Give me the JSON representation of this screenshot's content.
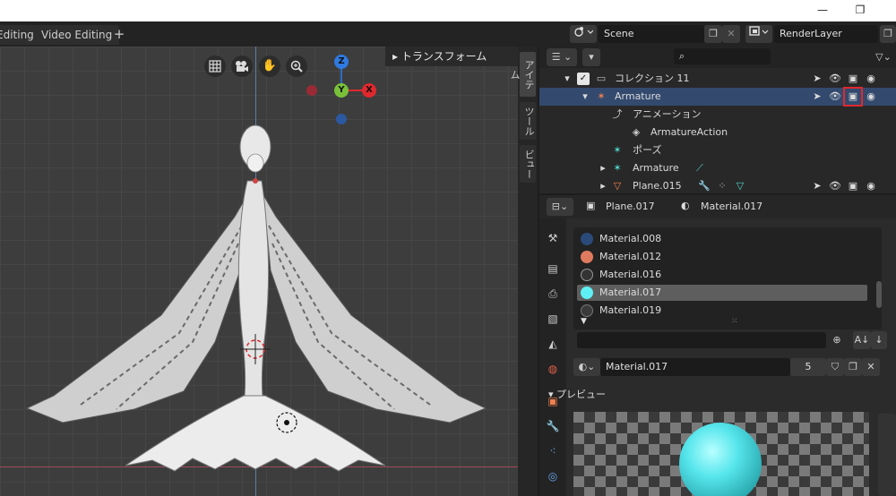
{
  "window": {
    "minimize": "—",
    "restore": "❐"
  },
  "workspace_tabs": [
    {
      "label": "Editing"
    },
    {
      "label": "Video Editing"
    }
  ],
  "workspace_add": "+",
  "scene": {
    "name": "Scene",
    "render_layer": "RenderLayer"
  },
  "viewport": {
    "nav_icons": [
      "grid-icon",
      "camera-icon",
      "hand-icon",
      "zoom-icon"
    ],
    "gizmo": {
      "z": "Z",
      "y": "Y",
      "x": "X"
    },
    "transform_header": "トランスフォーム"
  },
  "side_tabs": [
    "アイテム",
    "ツール",
    "ビュー"
  ],
  "outliner": {
    "search_placeholder": "",
    "rows": [
      {
        "label": "コレクション 11"
      },
      {
        "label": "Armature"
      },
      {
        "label": "アニメーション"
      },
      {
        "label": "ArmatureAction"
      },
      {
        "label": "ポーズ"
      },
      {
        "label": "Armature"
      },
      {
        "label": "Plane.015"
      }
    ]
  },
  "properties": {
    "object_name": "Plane.017",
    "material_name": "Material.017",
    "materials": [
      {
        "name": "Material.008",
        "color": "#2b4a7a"
      },
      {
        "name": "Material.012",
        "color": "#e07a5f"
      },
      {
        "name": "Material.016",
        "color": "#333333"
      },
      {
        "name": "Material.017",
        "color": "#5ef0f5"
      },
      {
        "name": "Material.019",
        "color": "#3a3a3a"
      }
    ],
    "slot_name": "Material.017",
    "user_count": "5",
    "preview_label": "プレビュー"
  },
  "colors": {
    "accent": "#4772b3",
    "highlight_red": "#e0282e"
  }
}
